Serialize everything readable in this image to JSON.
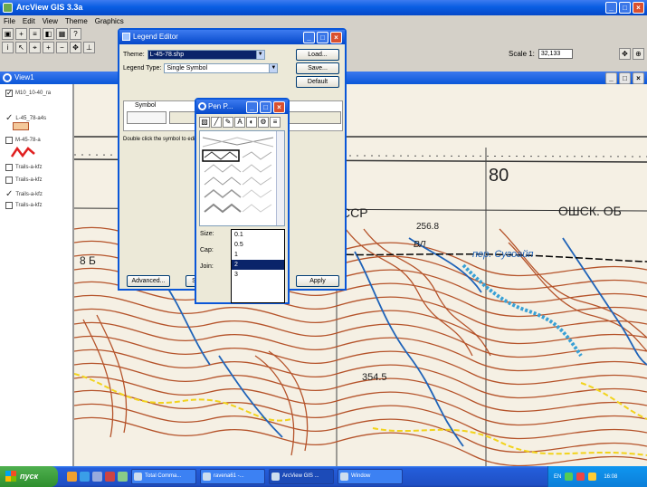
{
  "app": {
    "title": "ArcView GIS 3.3a"
  },
  "menu": [
    "File",
    "Edit",
    "View",
    "Theme",
    "Graphics"
  ],
  "scale": {
    "label": "Scale 1:",
    "value": "32,133"
  },
  "view": {
    "title": "View1"
  },
  "toc": {
    "items": [
      {
        "label": "M10_10-40_ra",
        "checked": true
      },
      {
        "label": "L-45_78-a4s",
        "checked": true
      },
      {
        "label": "M-45-78-a",
        "checked": false
      },
      {
        "label": "Trails-a-kfz",
        "checked": false
      },
      {
        "label": "Trails-a-kfz",
        "checked": false
      },
      {
        "label": "Trails-a-kfz",
        "checked": true
      },
      {
        "label": "Trails-a-kfz",
        "checked": false
      }
    ]
  },
  "legend_editor": {
    "title": "Legend Editor",
    "theme_label": "Theme:",
    "theme_value": "L-45-78.shp",
    "legend_type_label": "Legend Type:",
    "legend_type_value": "Single Symbol",
    "load_label": "Load...",
    "save_label": "Save...",
    "default_label": "Default",
    "symbol_header": "Symbol",
    "hint": "Double click the symbol to edit.",
    "advanced_label": "Advanced...",
    "statistics_label": "Statistics...",
    "apply_label": "Apply"
  },
  "pen_palette": {
    "title": "Pen P...",
    "size_label": "Size:",
    "cap_label": "Cap:",
    "join_label": "Join:",
    "size_value": "1",
    "size_options": [
      "0.1",
      "0.5",
      "1",
      "2",
      "3"
    ],
    "size_selected_index": 3
  },
  "map": {
    "labels": [
      "80",
      "CCP",
      "ОШСК. ОБ",
      "256.8",
      "пер. Сугоайп",
      "354.5",
      "ВЛ",
      "8 Б"
    ]
  },
  "taskbar": {
    "start_label": "пуск",
    "tasks": [
      "Total Comma...",
      "ravena61 -...",
      "ArcView GIS ...",
      "Window"
    ],
    "lang": "EN",
    "clock": "16:08"
  },
  "colors": {
    "contour": "#b5532a",
    "water": "#1f63b8",
    "river": "#37a0d6",
    "title_blue": "#0a56d8"
  }
}
